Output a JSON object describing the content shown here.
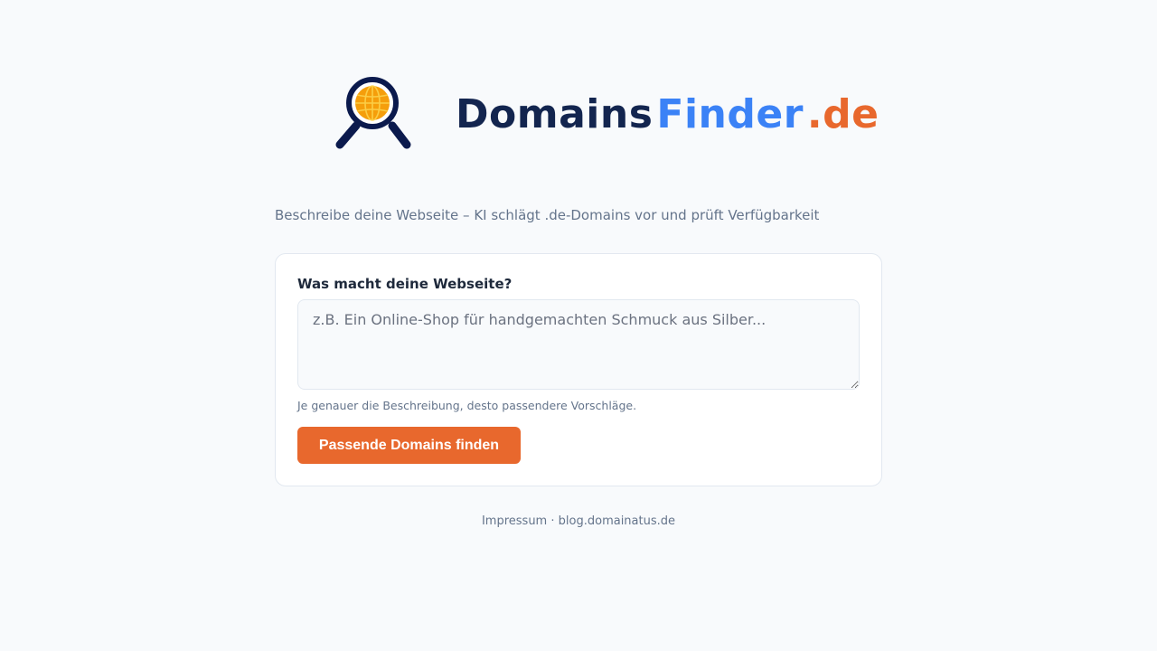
{
  "brand": {
    "part1": "Domains",
    "part2": "Finder",
    "part3": ".de",
    "icon": "magnifier-globe-icon",
    "colors": {
      "part1": "#13254f",
      "part2": "#3b82f6",
      "part3": "#e8682d",
      "icon_ring": "#0b1a4d",
      "icon_globe": "#f59e0b"
    }
  },
  "tagline": "Beschreibe deine Webseite – KI schlägt .de-Domains vor und prüft Verfügbarkeit",
  "form": {
    "label": "Was macht deine Webseite?",
    "value": "",
    "placeholder": "z.B. Ein Online-Shop für handgemachten Schmuck aus Silber...",
    "hint": "Je genauer die Beschreibung, desto passendere Vorschläge.",
    "submit_label": "Passende Domains finden"
  },
  "footer": {
    "impressum": "Impressum",
    "separator": "·",
    "blog": "blog.domainatus.de"
  },
  "colors": {
    "accent": "#e8682d",
    "background": "#f8fafc",
    "muted_text": "#64748b"
  }
}
